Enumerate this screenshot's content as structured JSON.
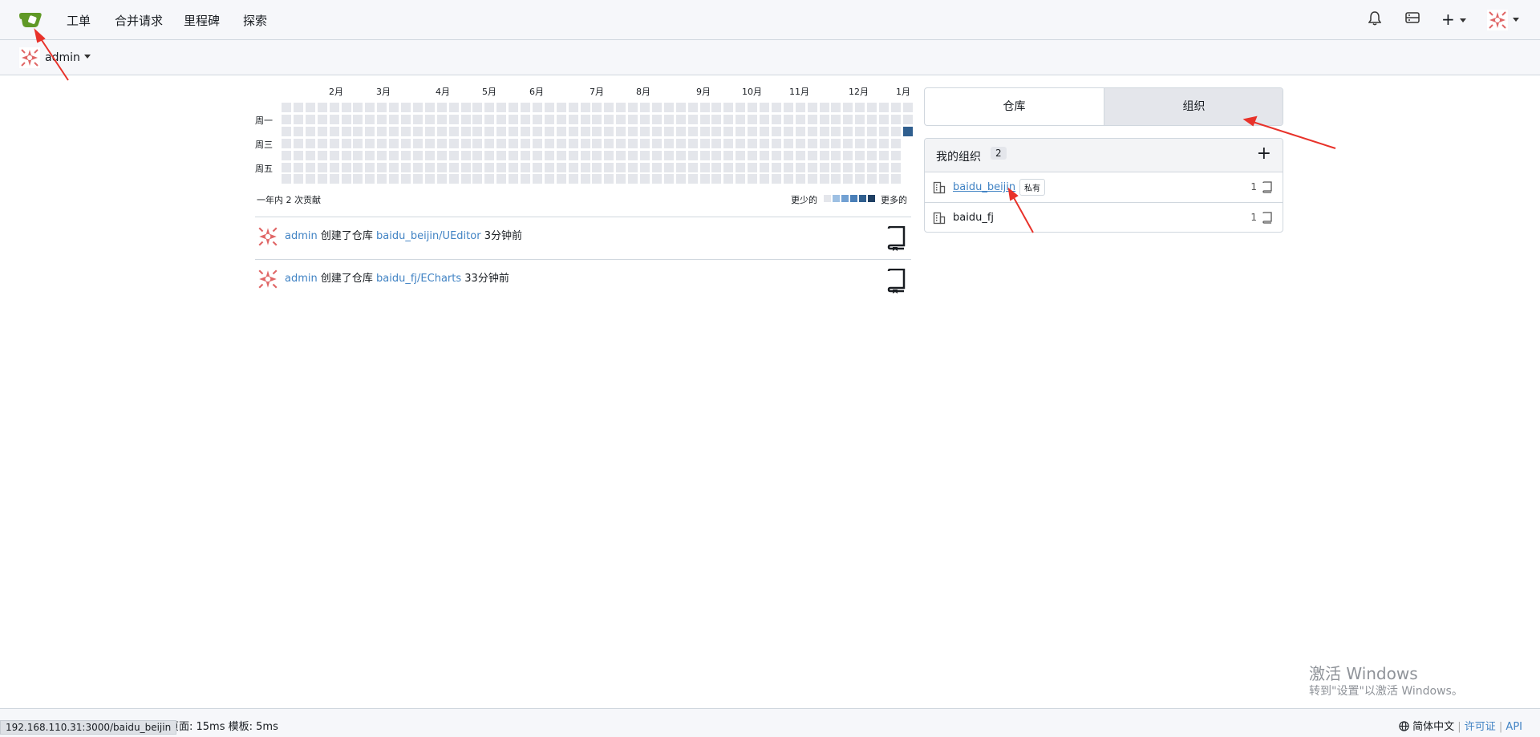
{
  "nav": {
    "items": [
      "工单",
      "合并请求",
      "里程碑",
      "探索"
    ]
  },
  "context": {
    "name": "admin"
  },
  "heatmap": {
    "months": [
      "2月",
      "3月",
      "4月",
      "5月",
      "6月",
      "7月",
      "8月",
      "9月",
      "10月",
      "11月",
      "12月",
      "1月"
    ],
    "days": [
      "周一",
      "周三",
      "周五"
    ],
    "summary": "一年内 2 次贡献",
    "legend_less": "更少的",
    "legend_more": "更多的",
    "colors": [
      "#e4e6eb",
      "#9ec0e3",
      "#72a1d3",
      "#4a7fb8",
      "#305f8f",
      "#1f3f63"
    ]
  },
  "feed": [
    {
      "user": "admin",
      "action": "创建了仓库",
      "repo": "baidu_beijin/UEditor",
      "time": "3分钟前"
    },
    {
      "user": "admin",
      "action": "创建了仓库",
      "repo": "baidu_fj/ECharts",
      "time": "33分钟前"
    }
  ],
  "tabs": [
    "仓库",
    "组织"
  ],
  "orgs": {
    "title": "我的组织",
    "count": "2",
    "items": [
      {
        "name": "baidu_beijin",
        "badge": "私有",
        "repos": "1"
      },
      {
        "name": "baidu_fj",
        "badge": "",
        "repos": "1"
      }
    ]
  },
  "footer": {
    "left": "页面: 15ms 模板: 5ms",
    "language": "简体中文",
    "license": "许可证",
    "api": "API"
  },
  "status_url": "192.168.110.31:3000/baidu_beijin",
  "watermark": {
    "line1": "激活 Windows",
    "line2": "转到\"设置\"以激活 Windows。"
  }
}
